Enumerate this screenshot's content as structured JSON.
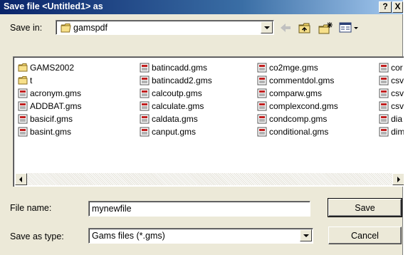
{
  "window": {
    "title": "Save file <Untitled1> as",
    "help_label": "?",
    "close_label": "X"
  },
  "save_in": {
    "label": "Save in:",
    "folder_icon": "folder-open-icon",
    "value": "gamspdf"
  },
  "toolbar": {
    "icons": [
      "back-arrow-icon",
      "up-folder-icon",
      "new-folder-icon",
      "views-menu-icon"
    ]
  },
  "files": [
    {
      "name": "GAMS2002",
      "type": "folder"
    },
    {
      "name": "t",
      "type": "folder"
    },
    {
      "name": "acronym.gms",
      "type": "gms"
    },
    {
      "name": "ADDBAT.gms",
      "type": "gms"
    },
    {
      "name": "basicif.gms",
      "type": "gms"
    },
    {
      "name": "basint.gms",
      "type": "gms"
    },
    {
      "name": "batincadd.gms",
      "type": "gms"
    },
    {
      "name": "batincadd2.gms",
      "type": "gms"
    },
    {
      "name": "calcoutp.gms",
      "type": "gms"
    },
    {
      "name": "calculate.gms",
      "type": "gms"
    },
    {
      "name": "caldata.gms",
      "type": "gms"
    },
    {
      "name": "canput.gms",
      "type": "gms"
    },
    {
      "name": "co2mge.gms",
      "type": "gms"
    },
    {
      "name": "commentdol.gms",
      "type": "gms"
    },
    {
      "name": "comparw.gms",
      "type": "gms"
    },
    {
      "name": "complexcond.gms",
      "type": "gms"
    },
    {
      "name": "condcomp.gms",
      "type": "gms"
    },
    {
      "name": "conditional.gms",
      "type": "gms"
    },
    {
      "name": "cor",
      "type": "gms"
    },
    {
      "name": "csv",
      "type": "gms"
    },
    {
      "name": "csv",
      "type": "gms"
    },
    {
      "name": "csv",
      "type": "gms"
    },
    {
      "name": "dia",
      "type": "gms"
    },
    {
      "name": "dim",
      "type": "gms"
    }
  ],
  "form": {
    "filename_label": "File name:",
    "filename_value": "mynewfile",
    "savetype_label": "Save as type:",
    "savetype_value": "Gams files (*.gms)"
  },
  "buttons": {
    "save": "Save",
    "cancel": "Cancel"
  }
}
